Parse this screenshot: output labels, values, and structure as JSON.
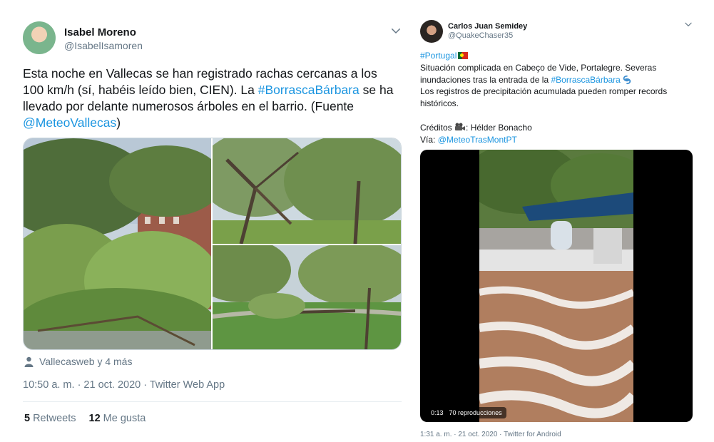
{
  "left_tweet": {
    "name": "Isabel Moreno",
    "handle": "@IsabelIsamoren",
    "text_part1": "Esta noche en Vallecas se han registrado rachas cercanas a los 100 km/h (sí, habéis leído bien, CIEN). La ",
    "hashtag": "#BorrascaBárbara",
    "text_part2": " se ha llevado por delante numerosos árboles en el barrio. (Fuente ",
    "mention": "@MeteoVallecas",
    "text_part3": ")",
    "tagged": "Vallecasweb y 4 más",
    "meta": "10:50 a. m. · 21 oct. 2020 · Twitter Web App",
    "retweets_count": "5",
    "retweets_label": "Retweets",
    "likes_count": "12",
    "likes_label": "Me gusta",
    "avatar_icon": "user-avatar",
    "caret_icon": "chevron-down-icon",
    "tagged_icon": "person-icon"
  },
  "right_tweet": {
    "name": "Carlos Juan Semidey",
    "handle": "@QuakeChaser35",
    "hashtag1": "#Portugal",
    "line2": "Situación complicada en Cabeço de Vide, Portalegre. Severas inundaciones tras la entrada de la ",
    "hashtag2": "#BorrascaBárbara",
    "line3": "Los registros de precipitación acumulada pueden romper records históricos.",
    "credits_prefix": "Créditos ",
    "credits_name": ": Hélder Bonacho",
    "via_prefix": "Vía: ",
    "via_mention": "@MeteoTrasMontPT",
    "video_time": "0:13",
    "video_views": "70 reproducciones",
    "meta": "1:31 a. m. · 21 oct. 2020 · Twitter for Android",
    "flag_icon": "portugal-flag-icon",
    "cyclone_icon": "cyclone-icon",
    "camera_icon": "movie-camera-icon"
  },
  "colors": {
    "link": "#1b95e0",
    "secondary": "#657786",
    "text": "#14171a",
    "divider": "#e6ecf0"
  }
}
